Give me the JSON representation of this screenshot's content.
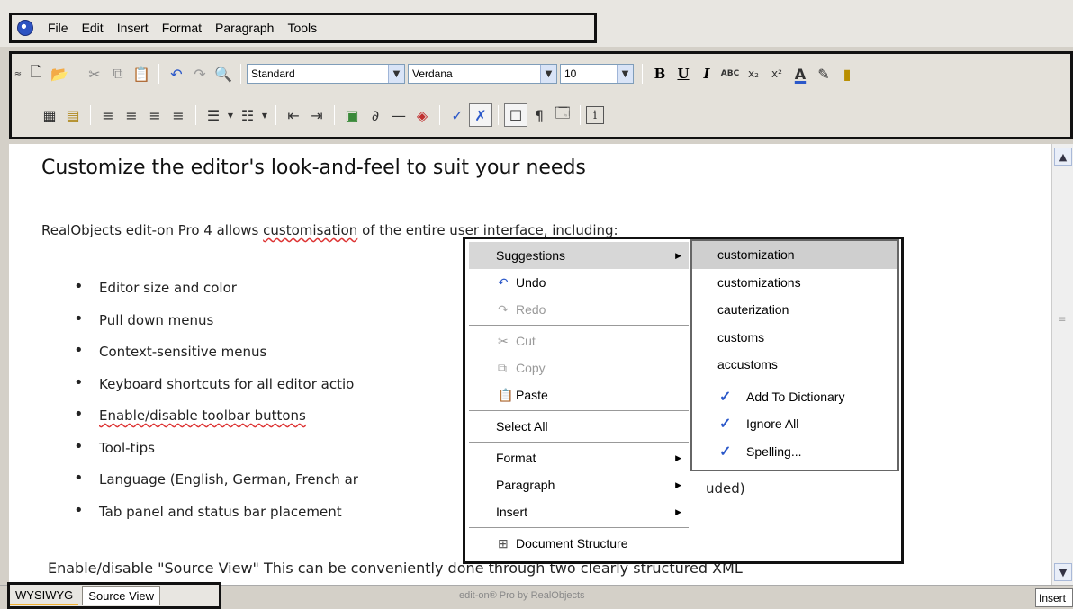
{
  "menubar": {
    "items": [
      "File",
      "Edit",
      "Insert",
      "Format",
      "Paragraph",
      "Tools"
    ]
  },
  "toolbar": {
    "style_value": "Standard",
    "font_value": "Verdana",
    "size_value": "10",
    "bold_label": "B",
    "underline_label": "U",
    "italic_label": "I"
  },
  "document": {
    "title": "Customize the editor's look-and-feel to suit your needs",
    "intro_prefix": "RealObjects edit-on Pro 4 allows ",
    "intro_misspelled": "customisation",
    "intro_suffix": " of the entire user interface, including:",
    "items": [
      "Editor size and color",
      "Pull down menus",
      "Context-sensitive menus",
      "Keyboard shortcuts for all editor actio",
      "Enable/disable toolbar buttons",
      "Tool-tips",
      "Language (English, German, French ar",
      "Tab panel and status bar placement"
    ],
    "item_list_suffix_language": "uded)",
    "footer": "Enable/disable \"Source View\" This can be conveniently done through two clearly structured XML"
  },
  "context_menu": {
    "items": [
      {
        "label": "Suggestions",
        "submenu": true
      },
      {
        "label": "Undo",
        "icon": "undo-icon"
      },
      {
        "label": "Redo",
        "icon": "redo-icon",
        "disabled": true
      },
      {
        "label": "Cut",
        "icon": "cut-icon",
        "disabled": true
      },
      {
        "label": "Copy",
        "icon": "copy-icon",
        "disabled": true
      },
      {
        "label": "Paste",
        "icon": "paste-icon"
      },
      {
        "label": "Select All"
      },
      {
        "label": "Format",
        "submenu": true
      },
      {
        "label": "Paragraph",
        "submenu": true
      },
      {
        "label": "Insert",
        "submenu": true
      },
      {
        "label": "Document Structure",
        "icon": "document-structure-icon"
      }
    ],
    "suggestions": [
      "customization",
      "customizations",
      "cauterization",
      "customs",
      "accustoms"
    ],
    "spell_actions": [
      "Add To Dictionary",
      "Ignore All",
      "Spelling..."
    ]
  },
  "tabs": {
    "wysiwyg": "WYSIWYG",
    "source": "Source View"
  },
  "status": {
    "center": "edit-on® Pro by RealObjects",
    "mode": "Insert"
  }
}
